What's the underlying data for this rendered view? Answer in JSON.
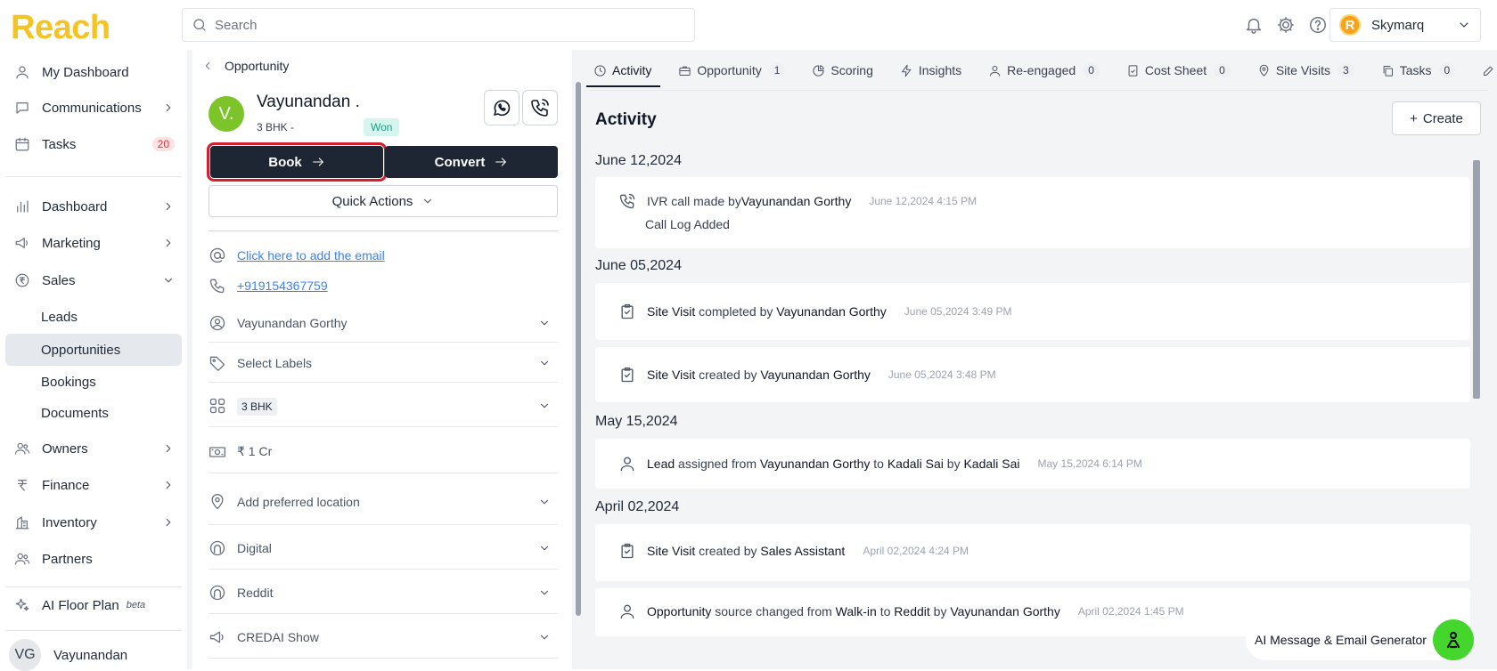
{
  "app": {
    "logo": "Reach"
  },
  "search": {
    "placeholder": "Search"
  },
  "account": {
    "name": "Skymarq",
    "logo_letter": "R"
  },
  "sidebar": {
    "my_dashboard": "My Dashboard",
    "communications": "Communications",
    "tasks": "Tasks",
    "tasks_count": "20",
    "dashboard": "Dashboard",
    "marketing": "Marketing",
    "sales": "Sales",
    "sales_sub": {
      "leads": "Leads",
      "opportunities": "Opportunities",
      "bookings": "Bookings",
      "documents": "Documents"
    },
    "owners": "Owners",
    "finance": "Finance",
    "inventory": "Inventory",
    "partners": "Partners",
    "ai_floor_plan": "AI Floor Plan",
    "beta": "beta",
    "user_initials": "VG",
    "user_name": "Vayunandan"
  },
  "opportunity": {
    "breadcrumb": "Opportunity",
    "avatar": "V.",
    "name": "Vayunandan .",
    "config": "3 BHK  -",
    "status": "Won",
    "book_label": "Book",
    "convert_label": "Convert",
    "quick_actions_label": "Quick Actions",
    "email_link": "Click here to add the email",
    "phone": "+919154367759",
    "fields": {
      "owner": "Vayunandan Gorthy",
      "labels": "Select Labels",
      "configuration": "3 BHK",
      "budget": "₹ 1 Cr",
      "location": "Add preferred location",
      "channel": "Digital",
      "source": "Reddit",
      "sub_source": "CREDAI Show"
    }
  },
  "tabs": [
    {
      "label": "Activity",
      "count": ""
    },
    {
      "label": "Opportunity",
      "count": "1"
    },
    {
      "label": "Scoring",
      "count": ""
    },
    {
      "label": "Insights",
      "count": ""
    },
    {
      "label": "Re-engaged",
      "count": "0"
    },
    {
      "label": "Cost Sheet",
      "count": "0"
    },
    {
      "label": "Site Visits",
      "count": "3"
    },
    {
      "label": "Tasks",
      "count": "0"
    }
  ],
  "activity": {
    "title": "Activity",
    "create_label": "Create",
    "groups": [
      {
        "date": "June 12,2024",
        "items": [
          {
            "parts": [
              "IVR call made by ",
              "Vayunandan Gorthy"
            ],
            "time": "June 12,2024 4:15 PM",
            "sub": "Call Log Added"
          }
        ]
      },
      {
        "date": "June 05,2024",
        "items": [
          {
            "parts": [
              "Site Visit",
              " completed by ",
              "Vayunandan Gorthy"
            ],
            "time": "June 05,2024 3:49 PM"
          },
          {
            "parts": [
              "Site Visit",
              " created by ",
              "Vayunandan Gorthy"
            ],
            "time": "June 05,2024 3:48 PM"
          }
        ]
      },
      {
        "date": "May 15,2024",
        "items": [
          {
            "parts": [
              "Lead",
              " assigned from ",
              "Vayunandan Gorthy",
              " to ",
              "Kadali Sai",
              " by ",
              "Kadali Sai"
            ],
            "time": "May 15,2024 6:14 PM"
          }
        ]
      },
      {
        "date": "April 02,2024",
        "items": [
          {
            "parts": [
              "Site Visit",
              " created by ",
              "Sales Assistant"
            ],
            "time": "April 02,2024 4:24 PM"
          },
          {
            "parts": [
              "Opportunity",
              " source changed from ",
              "Walk-in",
              " to ",
              "Reddit",
              " by ",
              "Vayunandan Gorthy"
            ],
            "time": "April 02,2024 1:45 PM"
          }
        ]
      }
    ]
  },
  "ai_generator": {
    "label": "AI Message & Email Generator"
  },
  "colors": {
    "brand": "#f6c324",
    "dark_button": "#1e2533",
    "won_bg": "#d7f5ef",
    "highlight": "#d32030",
    "ai_button": "#44d62c"
  }
}
